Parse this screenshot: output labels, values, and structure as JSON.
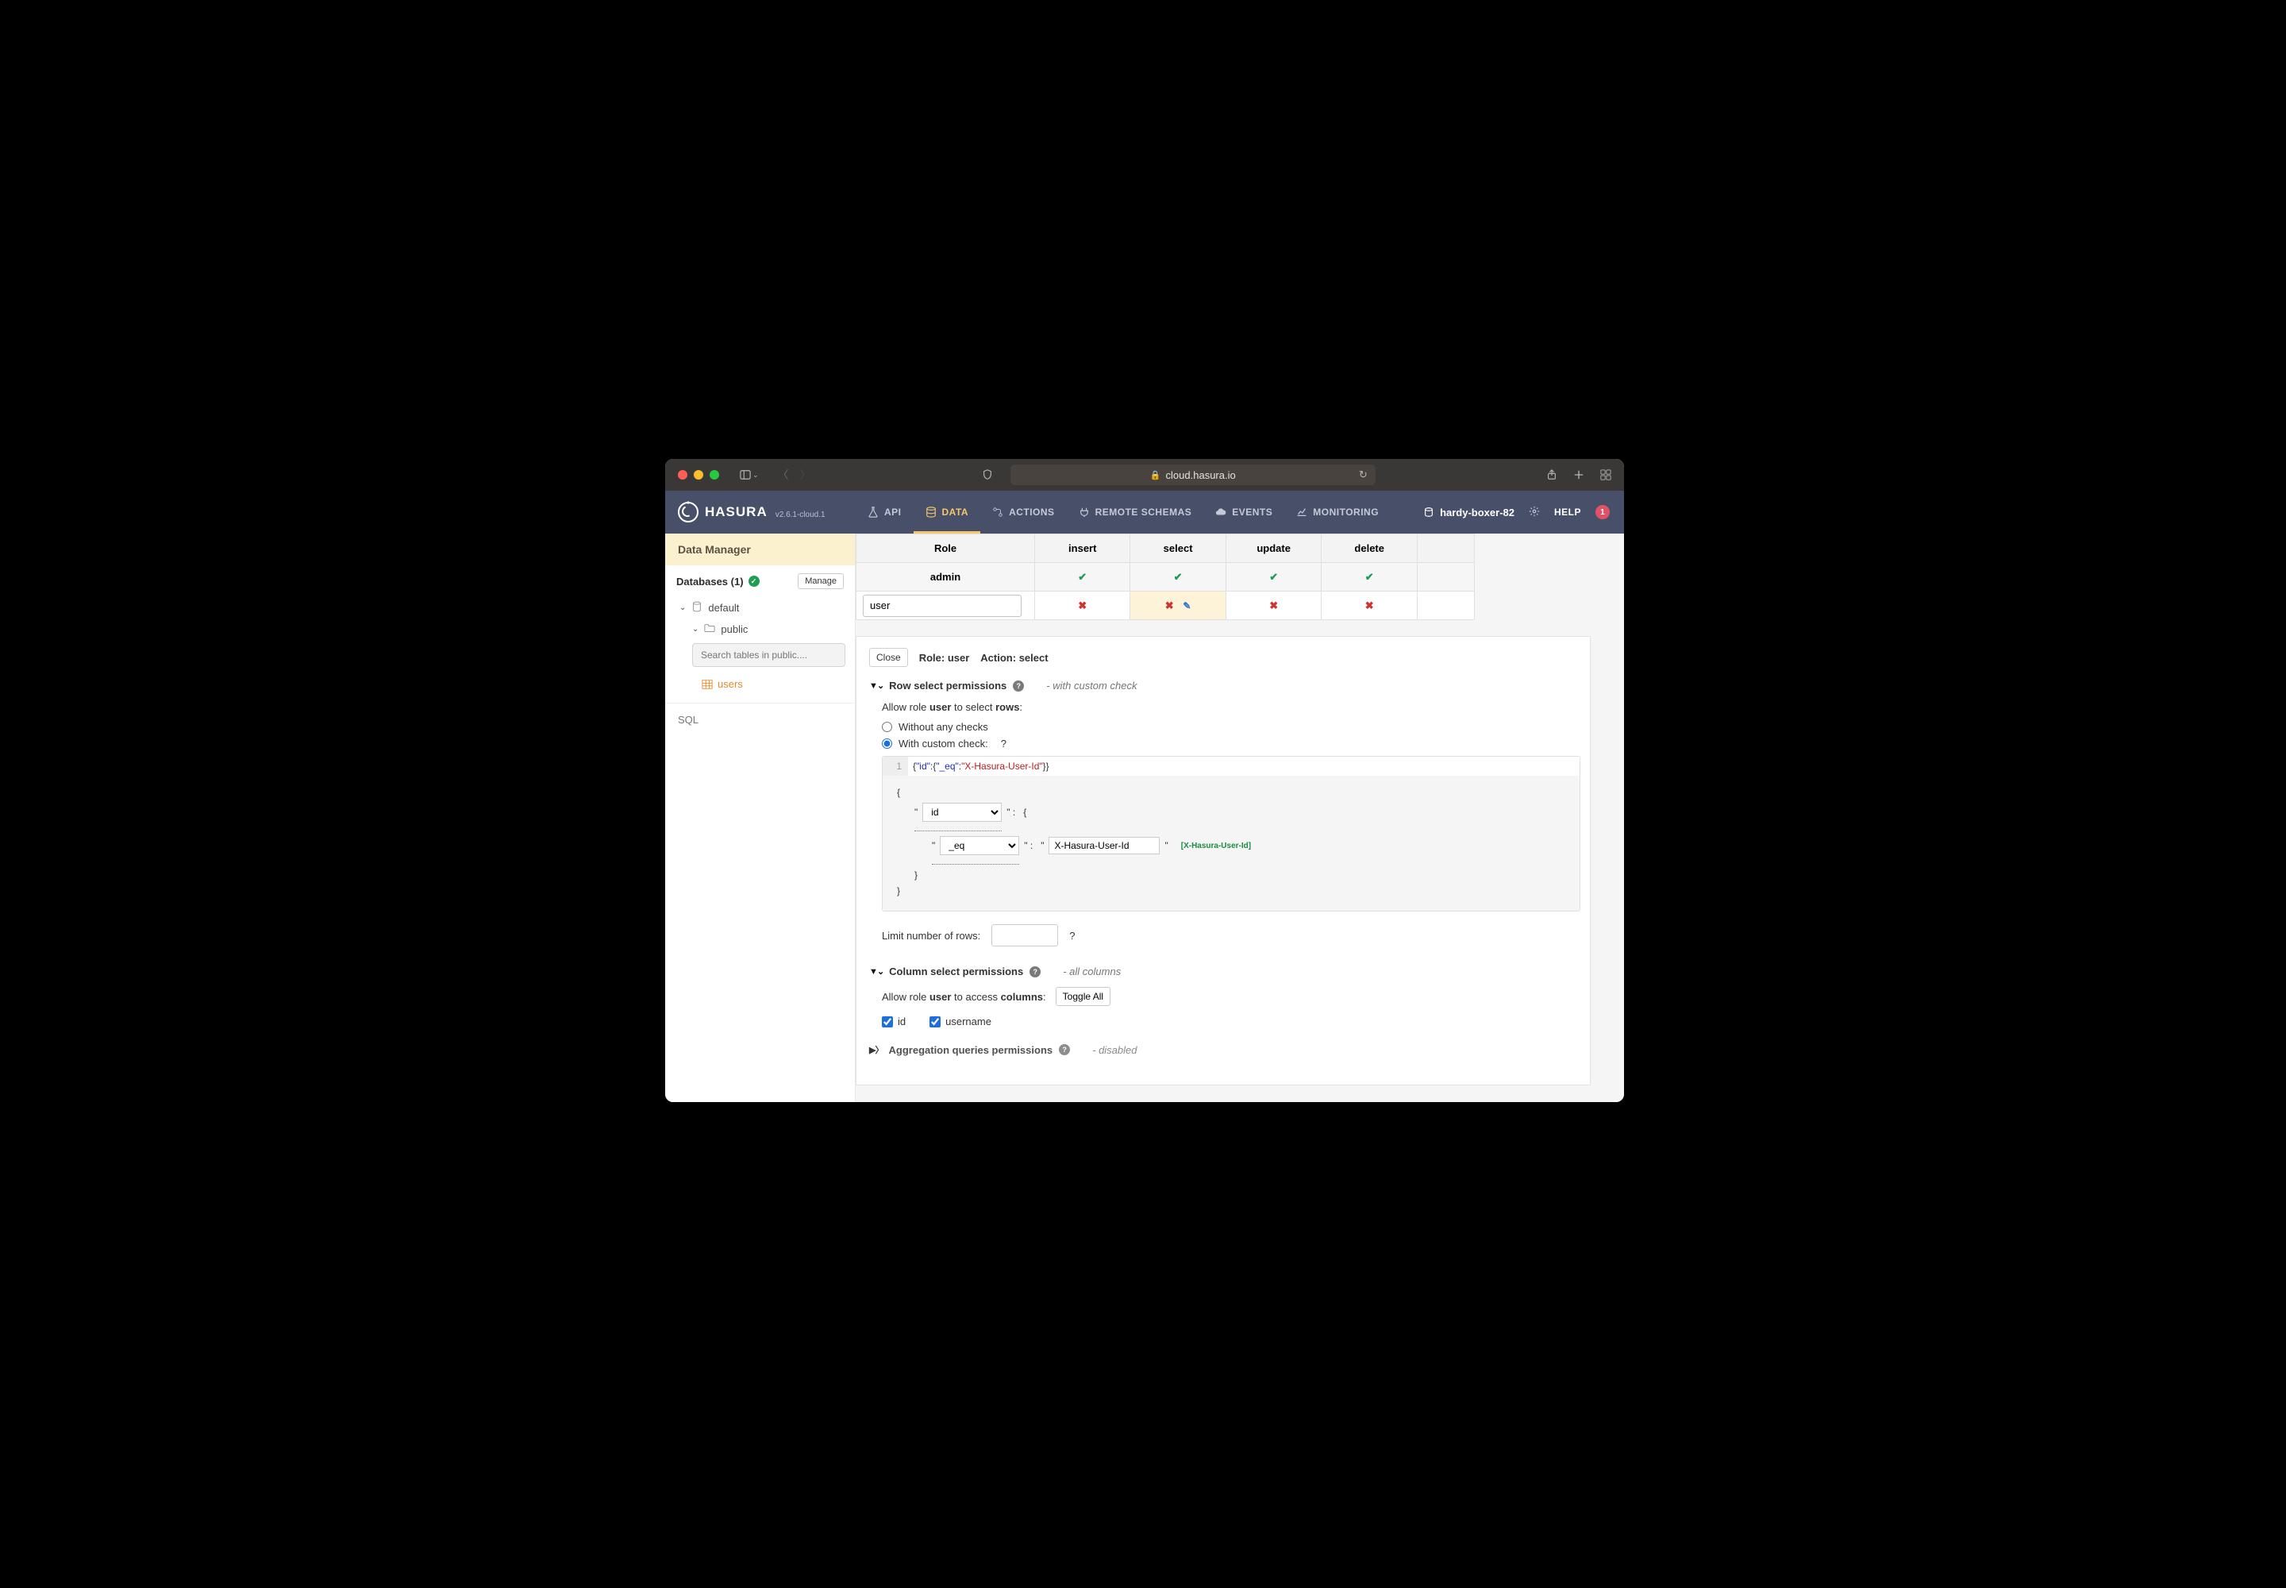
{
  "browser": {
    "url": "cloud.hasura.io"
  },
  "hasura": {
    "brand": "HASURA",
    "version": "v2.6.1-cloud.1",
    "tabs": {
      "api": "API",
      "data": "DATA",
      "actions": "ACTIONS",
      "remote": "REMOTE SCHEMAS",
      "events": "EVENTS",
      "monitoring": "MONITORING"
    },
    "project": "hardy-boxer-82",
    "help": "HELP",
    "notif_count": "1"
  },
  "sidebar": {
    "title": "Data Manager",
    "databases_label": "Databases (1)",
    "manage_btn": "Manage",
    "db_name": "default",
    "schema_name": "public",
    "search_placeholder": "Search tables in public....",
    "table_name": "users",
    "sql": "SQL"
  },
  "perm_table": {
    "headers": {
      "role": "Role",
      "insert": "insert",
      "select": "select",
      "update": "update",
      "delete": "delete"
    },
    "admin_row": {
      "role": "admin"
    },
    "user_row": {
      "role_value": "user"
    }
  },
  "panel": {
    "close": "Close",
    "role_label": "Role:",
    "role_value": "user",
    "action_label": "Action:",
    "action_value": "select",
    "row_perm": {
      "title": "Row select permissions",
      "note": "- with custom check",
      "allow_pre": "Allow role ",
      "allow_role": "user",
      "allow_mid": " to select ",
      "allow_target": "rows",
      "allow_post": ":",
      "opt_without": "Without any checks",
      "opt_custom": "With custom check:",
      "code_raw_pre": "{",
      "code_key_id": "\"id\"",
      "code_colon": ":",
      "code_brace2": "{",
      "code_key_eq": "\"_eq\"",
      "code_val": "\"X-Hasura-User-Id\"",
      "code_close": "}}",
      "builder": {
        "sel_id": "id",
        "sel_eq": "_eq",
        "input_val": "X-Hasura-User-Id",
        "hint": "[X-Hasura-User-Id]"
      },
      "limit_label": "Limit number of rows:"
    },
    "col_perm": {
      "title": "Column select permissions",
      "note": "- all columns",
      "allow_pre": "Allow role ",
      "allow_role": "user",
      "allow_mid": " to access ",
      "allow_target": "columns",
      "allow_post": ":",
      "toggle": "Toggle All",
      "cols": {
        "id": "id",
        "username": "username"
      }
    },
    "agg_perm": {
      "title": "Aggregation queries permissions",
      "note": "- disabled"
    }
  }
}
